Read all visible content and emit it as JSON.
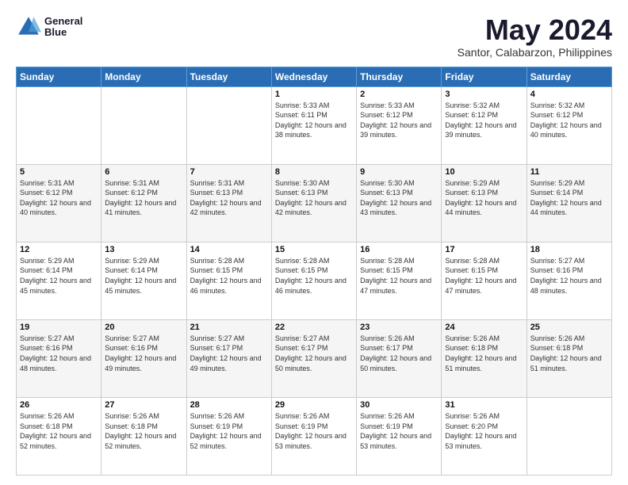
{
  "logo": {
    "line1": "General",
    "line2": "Blue"
  },
  "title": "May 2024",
  "location": "Santor, Calabarzon, Philippines",
  "days_of_week": [
    "Sunday",
    "Monday",
    "Tuesday",
    "Wednesday",
    "Thursday",
    "Friday",
    "Saturday"
  ],
  "weeks": [
    [
      {
        "num": "",
        "sunrise": "",
        "sunset": "",
        "daylight": ""
      },
      {
        "num": "",
        "sunrise": "",
        "sunset": "",
        "daylight": ""
      },
      {
        "num": "",
        "sunrise": "",
        "sunset": "",
        "daylight": ""
      },
      {
        "num": "1",
        "sunrise": "Sunrise: 5:33 AM",
        "sunset": "Sunset: 6:11 PM",
        "daylight": "Daylight: 12 hours and 38 minutes."
      },
      {
        "num": "2",
        "sunrise": "Sunrise: 5:33 AM",
        "sunset": "Sunset: 6:12 PM",
        "daylight": "Daylight: 12 hours and 39 minutes."
      },
      {
        "num": "3",
        "sunrise": "Sunrise: 5:32 AM",
        "sunset": "Sunset: 6:12 PM",
        "daylight": "Daylight: 12 hours and 39 minutes."
      },
      {
        "num": "4",
        "sunrise": "Sunrise: 5:32 AM",
        "sunset": "Sunset: 6:12 PM",
        "daylight": "Daylight: 12 hours and 40 minutes."
      }
    ],
    [
      {
        "num": "5",
        "sunrise": "Sunrise: 5:31 AM",
        "sunset": "Sunset: 6:12 PM",
        "daylight": "Daylight: 12 hours and 40 minutes."
      },
      {
        "num": "6",
        "sunrise": "Sunrise: 5:31 AM",
        "sunset": "Sunset: 6:12 PM",
        "daylight": "Daylight: 12 hours and 41 minutes."
      },
      {
        "num": "7",
        "sunrise": "Sunrise: 5:31 AM",
        "sunset": "Sunset: 6:13 PM",
        "daylight": "Daylight: 12 hours and 42 minutes."
      },
      {
        "num": "8",
        "sunrise": "Sunrise: 5:30 AM",
        "sunset": "Sunset: 6:13 PM",
        "daylight": "Daylight: 12 hours and 42 minutes."
      },
      {
        "num": "9",
        "sunrise": "Sunrise: 5:30 AM",
        "sunset": "Sunset: 6:13 PM",
        "daylight": "Daylight: 12 hours and 43 minutes."
      },
      {
        "num": "10",
        "sunrise": "Sunrise: 5:29 AM",
        "sunset": "Sunset: 6:13 PM",
        "daylight": "Daylight: 12 hours and 44 minutes."
      },
      {
        "num": "11",
        "sunrise": "Sunrise: 5:29 AM",
        "sunset": "Sunset: 6:14 PM",
        "daylight": "Daylight: 12 hours and 44 minutes."
      }
    ],
    [
      {
        "num": "12",
        "sunrise": "Sunrise: 5:29 AM",
        "sunset": "Sunset: 6:14 PM",
        "daylight": "Daylight: 12 hours and 45 minutes."
      },
      {
        "num": "13",
        "sunrise": "Sunrise: 5:29 AM",
        "sunset": "Sunset: 6:14 PM",
        "daylight": "Daylight: 12 hours and 45 minutes."
      },
      {
        "num": "14",
        "sunrise": "Sunrise: 5:28 AM",
        "sunset": "Sunset: 6:15 PM",
        "daylight": "Daylight: 12 hours and 46 minutes."
      },
      {
        "num": "15",
        "sunrise": "Sunrise: 5:28 AM",
        "sunset": "Sunset: 6:15 PM",
        "daylight": "Daylight: 12 hours and 46 minutes."
      },
      {
        "num": "16",
        "sunrise": "Sunrise: 5:28 AM",
        "sunset": "Sunset: 6:15 PM",
        "daylight": "Daylight: 12 hours and 47 minutes."
      },
      {
        "num": "17",
        "sunrise": "Sunrise: 5:28 AM",
        "sunset": "Sunset: 6:15 PM",
        "daylight": "Daylight: 12 hours and 47 minutes."
      },
      {
        "num": "18",
        "sunrise": "Sunrise: 5:27 AM",
        "sunset": "Sunset: 6:16 PM",
        "daylight": "Daylight: 12 hours and 48 minutes."
      }
    ],
    [
      {
        "num": "19",
        "sunrise": "Sunrise: 5:27 AM",
        "sunset": "Sunset: 6:16 PM",
        "daylight": "Daylight: 12 hours and 48 minutes."
      },
      {
        "num": "20",
        "sunrise": "Sunrise: 5:27 AM",
        "sunset": "Sunset: 6:16 PM",
        "daylight": "Daylight: 12 hours and 49 minutes."
      },
      {
        "num": "21",
        "sunrise": "Sunrise: 5:27 AM",
        "sunset": "Sunset: 6:17 PM",
        "daylight": "Daylight: 12 hours and 49 minutes."
      },
      {
        "num": "22",
        "sunrise": "Sunrise: 5:27 AM",
        "sunset": "Sunset: 6:17 PM",
        "daylight": "Daylight: 12 hours and 50 minutes."
      },
      {
        "num": "23",
        "sunrise": "Sunrise: 5:26 AM",
        "sunset": "Sunset: 6:17 PM",
        "daylight": "Daylight: 12 hours and 50 minutes."
      },
      {
        "num": "24",
        "sunrise": "Sunrise: 5:26 AM",
        "sunset": "Sunset: 6:18 PM",
        "daylight": "Daylight: 12 hours and 51 minutes."
      },
      {
        "num": "25",
        "sunrise": "Sunrise: 5:26 AM",
        "sunset": "Sunset: 6:18 PM",
        "daylight": "Daylight: 12 hours and 51 minutes."
      }
    ],
    [
      {
        "num": "26",
        "sunrise": "Sunrise: 5:26 AM",
        "sunset": "Sunset: 6:18 PM",
        "daylight": "Daylight: 12 hours and 52 minutes."
      },
      {
        "num": "27",
        "sunrise": "Sunrise: 5:26 AM",
        "sunset": "Sunset: 6:18 PM",
        "daylight": "Daylight: 12 hours and 52 minutes."
      },
      {
        "num": "28",
        "sunrise": "Sunrise: 5:26 AM",
        "sunset": "Sunset: 6:19 PM",
        "daylight": "Daylight: 12 hours and 52 minutes."
      },
      {
        "num": "29",
        "sunrise": "Sunrise: 5:26 AM",
        "sunset": "Sunset: 6:19 PM",
        "daylight": "Daylight: 12 hours and 53 minutes."
      },
      {
        "num": "30",
        "sunrise": "Sunrise: 5:26 AM",
        "sunset": "Sunset: 6:19 PM",
        "daylight": "Daylight: 12 hours and 53 minutes."
      },
      {
        "num": "31",
        "sunrise": "Sunrise: 5:26 AM",
        "sunset": "Sunset: 6:20 PM",
        "daylight": "Daylight: 12 hours and 53 minutes."
      },
      {
        "num": "",
        "sunrise": "",
        "sunset": "",
        "daylight": ""
      }
    ]
  ]
}
